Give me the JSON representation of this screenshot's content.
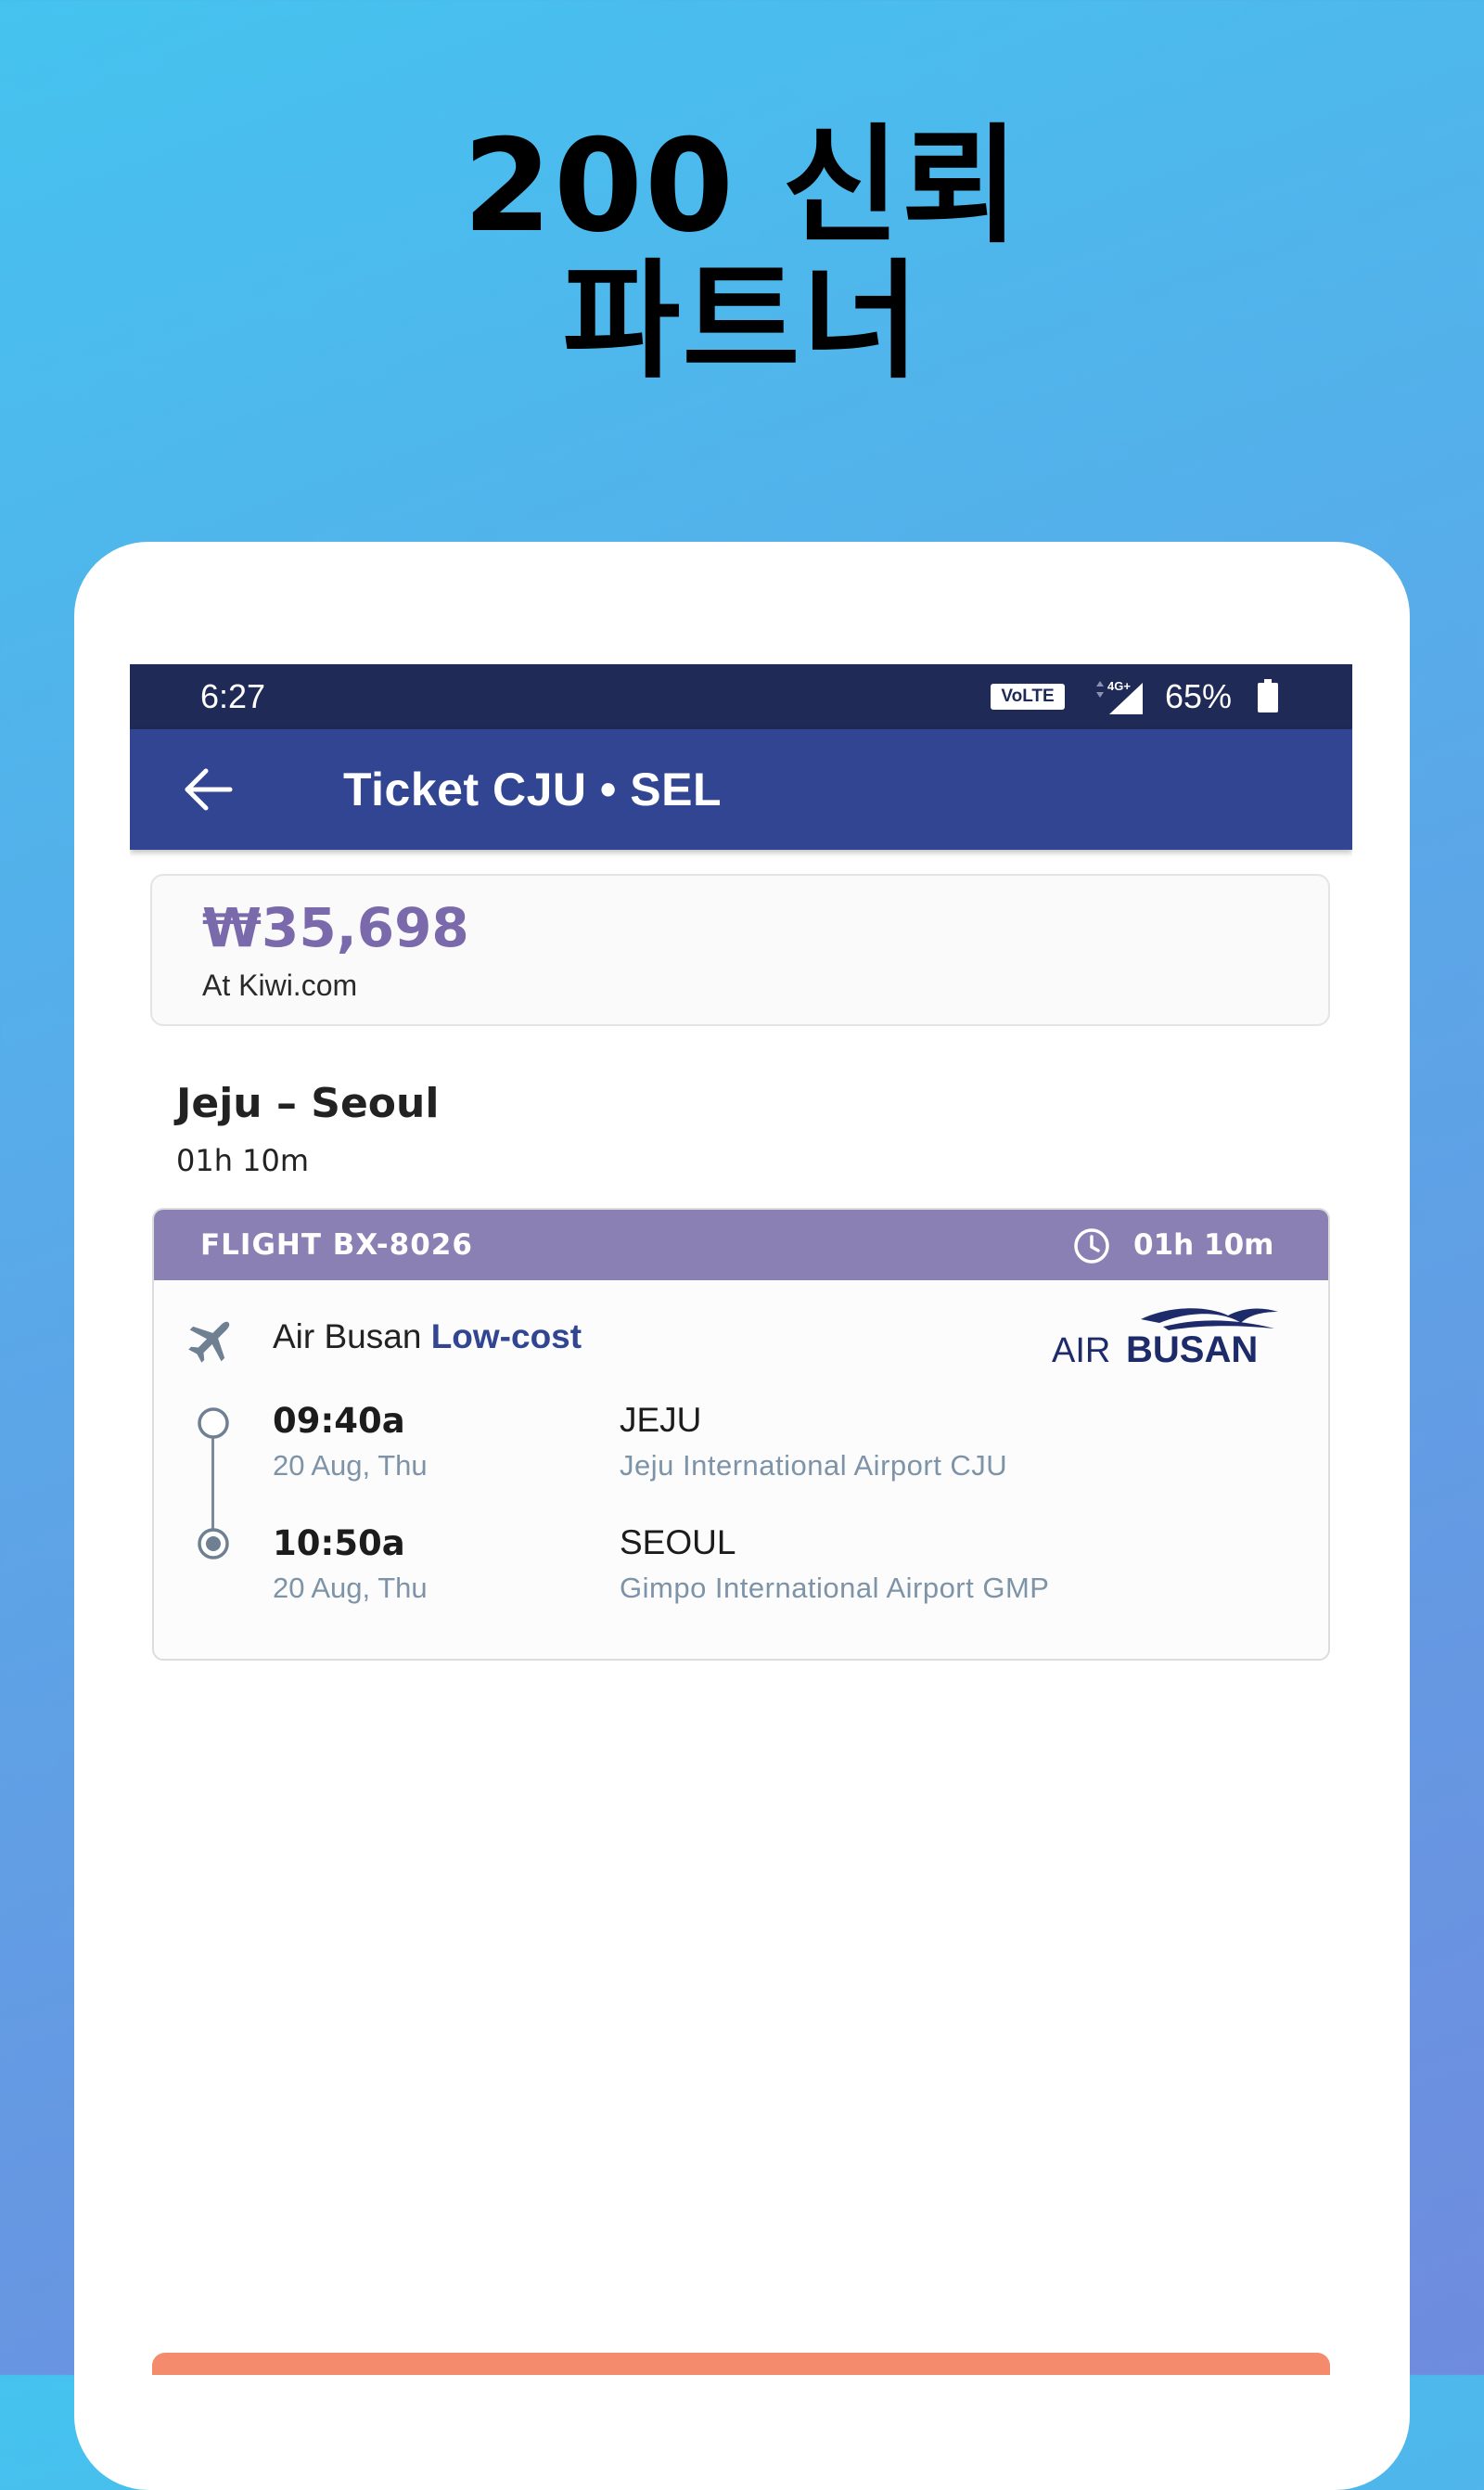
{
  "headline": {
    "line1": "200 신뢰",
    "line2": "파트너"
  },
  "status_bar": {
    "time": "6:27",
    "volte": "VoLTE",
    "network": "4G+",
    "battery": "65%"
  },
  "app_bar": {
    "back_icon": "arrow-left-icon",
    "title": "Ticket CJU • SEL"
  },
  "price": {
    "amount": "₩35,698",
    "source": "At Kiwi.com"
  },
  "route": {
    "title": "Jeju – Seoul",
    "duration": "01h 10m"
  },
  "flight": {
    "number": "FLIGHT BX-8026",
    "duration": "01h 10m",
    "airline": "Air Busan",
    "fare_type": "Low-cost",
    "logo": {
      "prefix": "AIR",
      "name": "BUSAN"
    },
    "departure": {
      "time": "09:40a",
      "date": "20 Aug, Thu",
      "city": "JEJU",
      "airport": "Jeju International Airport CJU"
    },
    "arrival": {
      "time": "10:50a",
      "date": "20 Aug, Thu",
      "city": "SEOUL",
      "airport": "Gimpo International Airport GMP"
    }
  },
  "colors": {
    "app_bar": "#314592",
    "status_bar": "#1f2a56",
    "flight_header": "#8a80b4",
    "price": "#7a6aab",
    "cta": "#f48b6d"
  }
}
